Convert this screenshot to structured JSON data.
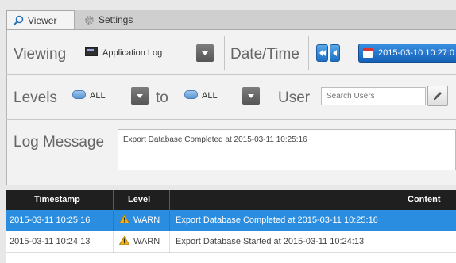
{
  "tabs": [
    {
      "label": "Viewer",
      "icon": "search-icon",
      "active": true
    },
    {
      "label": "Settings",
      "icon": "gear-icon",
      "active": false
    }
  ],
  "filters": {
    "viewing_label": "Viewing",
    "source_value": "Application Log",
    "datetime_label": "Date/Time",
    "datetime_value": "2015-03-10 10:27:0",
    "levels_label": "Levels",
    "level_from": "ALL",
    "to_label": "to",
    "level_to": "ALL",
    "user_label": "User",
    "user_placeholder": "Search Users",
    "message_label": "Log Message",
    "message_value": "Export Database Completed at 2015-03-11 10:25:16"
  },
  "table": {
    "columns": [
      "Timestamp",
      "Level",
      "Content"
    ],
    "rows": [
      {
        "timestamp": "2015-03-11 10:25:16",
        "level": "WARN",
        "content": "Export Database Completed at 2015-03-11 10:25:16",
        "selected": true
      },
      {
        "timestamp": "2015-03-11 10:24:13",
        "level": "WARN",
        "content": "Export Database Started at 2015-03-11 10:24:13",
        "selected": false
      }
    ]
  },
  "colors": {
    "accent": "#2a8de0",
    "header_bg": "#1f1f1f",
    "warn": "#f2b21b"
  }
}
